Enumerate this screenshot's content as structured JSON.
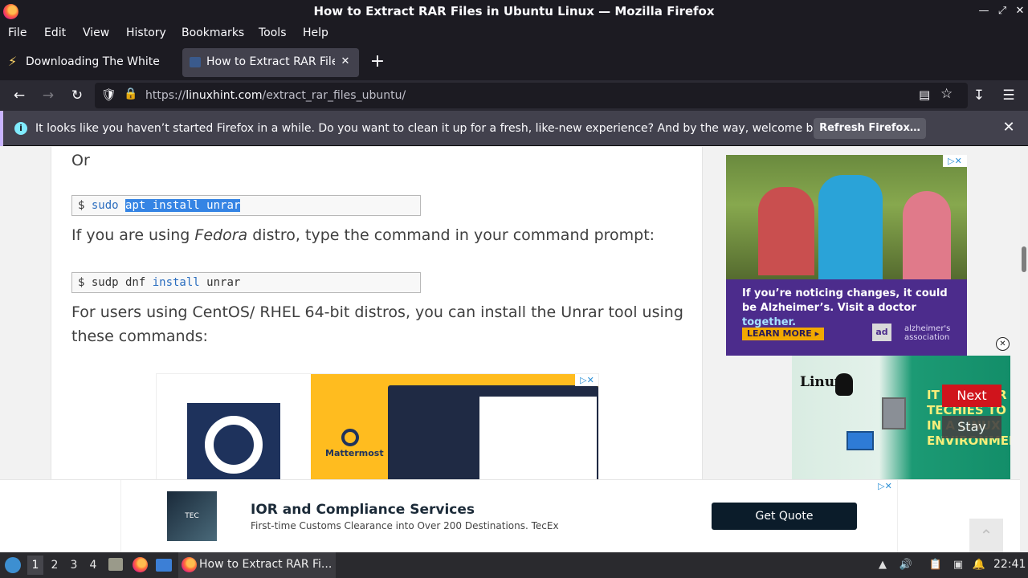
{
  "window": {
    "title": "How to Extract RAR Files in Ubuntu Linux — Mozilla Firefox"
  },
  "menubar": {
    "items": [
      "File",
      "Edit",
      "View",
      "History",
      "Bookmarks",
      "Tools",
      "Help"
    ]
  },
  "tabs": [
    {
      "label": "Downloading The White Lotus",
      "active": false
    },
    {
      "label": "How to Extract RAR Files in Ubuntu Linux",
      "active": true
    }
  ],
  "urlbar": {
    "scheme": "https://",
    "host": "linuxhint.com",
    "path": "/extract_rar_files_ubuntu/"
  },
  "notification": {
    "text": "It looks like you haven’t started Firefox in a while. Do you want to clean it up for a fresh, like-new experience? And by the way, welcome back!",
    "button": "Refresh Firefox…"
  },
  "article": {
    "or_text": "Or",
    "cmd1_prompt": "$ ",
    "cmd1_a": "sudo",
    "cmd1_sel": "apt install unrar",
    "fedora_pre": "If you are using ",
    "fedora_em": "Fedora",
    "fedora_post": " distro, type the command in your command prompt:",
    "cmd2_prompt": "$ ",
    "cmd2_a": "sudp dnf ",
    "cmd2_kw": "install",
    "cmd2_b": " unrar",
    "centos_line1": "For users using CentOS/ RHEL 64-bit distros, you can install the Unrar tool using",
    "centos_line2": "these commands:"
  },
  "ads": {
    "mattermost_brand": "Mattermost",
    "alz_text_a": "If you’re noticing changes, it could be Alzheimer’s. Visit a doctor ",
    "alz_text_hl": "together.",
    "alz_learn": "LEARN MORE",
    "alz_ad": "ad",
    "alz_brand": "alzheimer's association",
    "linux_title": "Linux",
    "linux_green": "IT IS ... FOR TECHIES TO ... IN A LINUX ENVIRONMENT",
    "next": "Next",
    "stay": "Stay",
    "anchor_title": "IOR and Compliance Services",
    "anchor_sub": "First-time Customs Clearance into Over 200 Destinations. TecEx",
    "anchor_button": "Get Quote",
    "tec_logo": "TEC"
  },
  "taskbar": {
    "workspaces": [
      "1",
      "2",
      "3",
      "4"
    ],
    "task_label": "How to Extract RAR Fi...",
    "clock": "22:41"
  }
}
